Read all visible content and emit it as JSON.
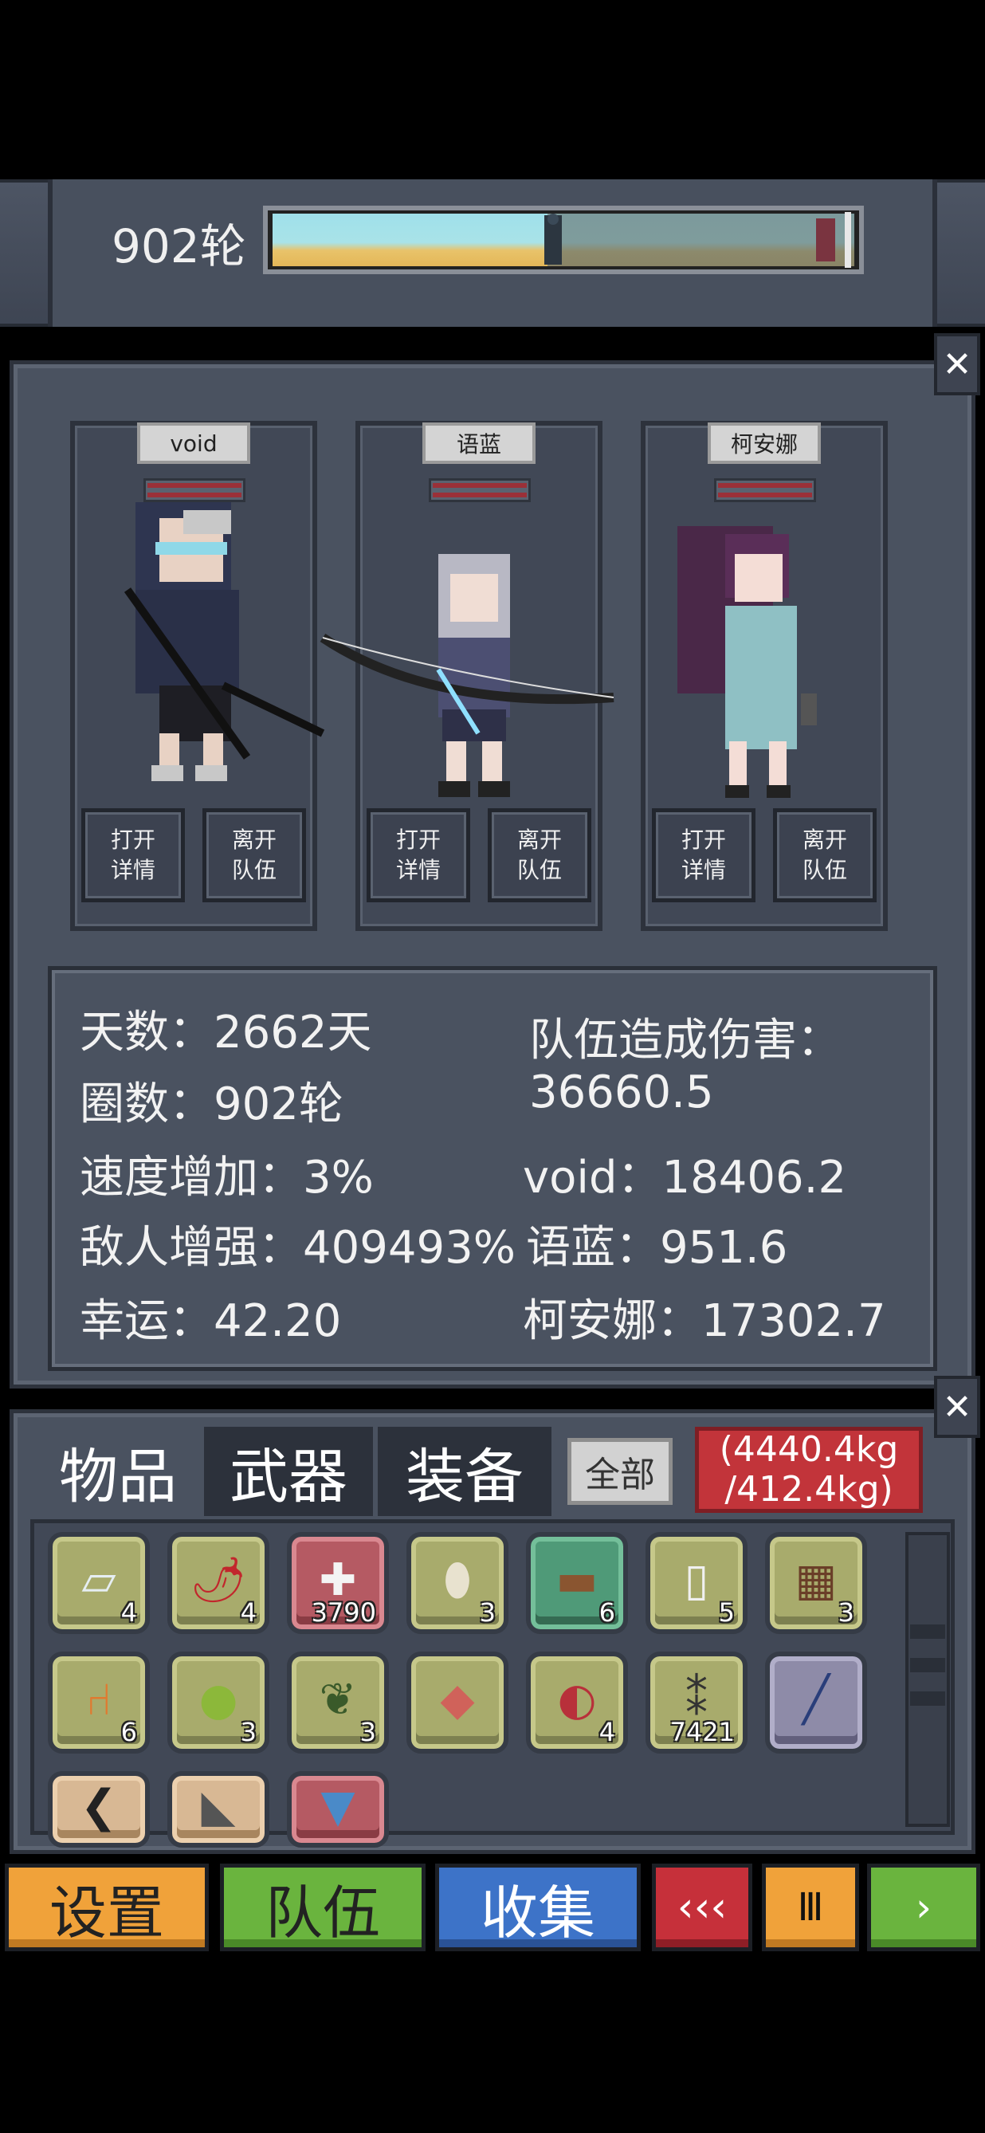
{
  "header": {
    "round": "902轮",
    "progress_fraction": 0.45
  },
  "team": {
    "members": [
      {
        "name": "void",
        "open_label": "打开\n详情",
        "leave_label": "离开\n队伍"
      },
      {
        "name": "语蓝",
        "open_label": "打开\n详情",
        "leave_label": "离开\n队伍"
      },
      {
        "name": "柯安娜",
        "open_label": "打开\n详情",
        "leave_label": "离开\n队伍"
      }
    ],
    "button_open_line1": "打开",
    "button_open_line2": "详情",
    "button_leave_line1": "离开",
    "button_leave_line2": "队伍"
  },
  "stats": {
    "days": "天数：2662天",
    "laps": "圈数：902轮",
    "speed": "速度增加：3%",
    "enemy": "敌人增强：409493%",
    "luck": "幸运：42.20",
    "damage_label": "队伍造成伤害：",
    "damage_total": "36660.5",
    "damage_void": "void：18406.2",
    "damage_yulan": "语蓝：951.6",
    "damage_keanna": "柯安娜：17302.7"
  },
  "inventory": {
    "tabs": [
      "物品",
      "武器",
      "装备"
    ],
    "filter": "全部",
    "weight_line1": "(4440.4kg",
    "weight_line2": "/412.4kg)",
    "items": [
      {
        "icon": "cloth-icon",
        "count": "4",
        "color": "olive"
      },
      {
        "icon": "chili-icon",
        "count": "4",
        "color": "olive"
      },
      {
        "icon": "medkit-icon",
        "count": "3790",
        "color": "red"
      },
      {
        "icon": "egg-icon",
        "count": "3",
        "color": "olive"
      },
      {
        "icon": "wood-log-icon",
        "count": "6",
        "color": "green"
      },
      {
        "icon": "milk-bottle-icon",
        "count": "5",
        "color": "olive"
      },
      {
        "icon": "chocolate-icon",
        "count": "3",
        "color": "olive"
      },
      {
        "icon": "chair-icon",
        "count": "6",
        "color": "olive"
      },
      {
        "icon": "apple-icon",
        "count": "3",
        "color": "olive"
      },
      {
        "icon": "herb-icon",
        "count": "3",
        "color": "olive"
      },
      {
        "icon": "fish-fillet-icon",
        "count": "",
        "color": "olive"
      },
      {
        "icon": "meat-icon",
        "count": "4",
        "color": "olive"
      },
      {
        "icon": "ammo-icon",
        "count": "7421",
        "color": "olive"
      },
      {
        "icon": "flashlight-icon",
        "count": "",
        "color": "purple"
      },
      {
        "icon": "bow-part-icon",
        "count": "",
        "color": "tan"
      },
      {
        "icon": "stone-tool-icon",
        "count": "",
        "color": "tan"
      },
      {
        "icon": "shirt-icon",
        "count": "",
        "color": "red"
      }
    ]
  },
  "bottom": {
    "settings": "设置",
    "team": "队伍",
    "collect": "收集",
    "rewind": "‹‹‹",
    "pause": "Ⅲ",
    "play": "›"
  }
}
